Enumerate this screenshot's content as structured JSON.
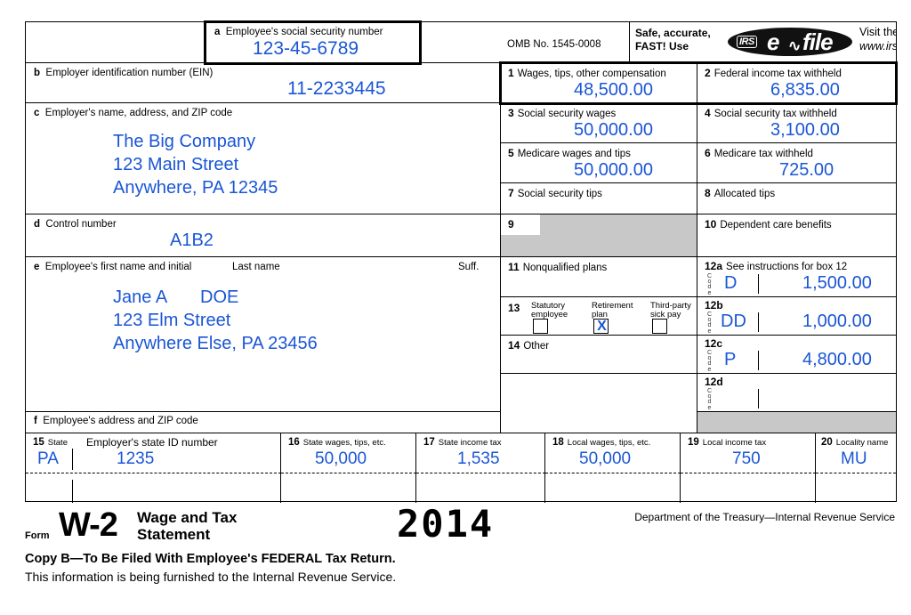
{
  "form": {
    "omb": "OMB No. 1545-0008",
    "efile": {
      "safe_line1": "Safe, accurate,",
      "safe_line2": "FAST! Use",
      "logo_irs": "IRS",
      "logo_e": "e",
      "logo_bolt": "✐",
      "logo_file": "file",
      "visit_line1": "Visit the IRS website at",
      "visit_line2": "www.irs.gov/efile"
    },
    "box_a": {
      "letter": "a",
      "label": "Employee's social security number",
      "value": "123-45-6789"
    },
    "box_b": {
      "letter": "b",
      "label": "Employer identification number (EIN)",
      "value": "11-2233445"
    },
    "box_c": {
      "letter": "c",
      "label": "Employer's name, address, and ZIP code",
      "line1": "The Big Company",
      "line2": "123 Main Street",
      "line3": "Anywhere, PA 12345"
    },
    "box_d": {
      "letter": "d",
      "label": "Control number",
      "value": "A1B2"
    },
    "box_e": {
      "letter": "e",
      "label_first": "Employee's first name and initial",
      "label_last": "Last name",
      "label_suffix": "Suff.",
      "first_name": "Jane A",
      "last_name": "DOE",
      "line2": "123 Elm Street",
      "line3": "Anywhere Else, PA 23456"
    },
    "box_f": {
      "letter": "f",
      "label": "Employee's address and ZIP code"
    },
    "box_1": {
      "num": "1",
      "label": "Wages, tips, other compensation",
      "value": "48,500.00"
    },
    "box_2": {
      "num": "2",
      "label": "Federal income tax withheld",
      "value": "6,835.00"
    },
    "box_3": {
      "num": "3",
      "label": "Social security wages",
      "value": "50,000.00"
    },
    "box_4": {
      "num": "4",
      "label": "Social security tax withheld",
      "value": "3,100.00"
    },
    "box_5": {
      "num": "5",
      "label": "Medicare wages and tips",
      "value": "50,000.00"
    },
    "box_6": {
      "num": "6",
      "label": "Medicare tax withheld",
      "value": "725.00"
    },
    "box_7": {
      "num": "7",
      "label": "Social security tips",
      "value": ""
    },
    "box_8": {
      "num": "8",
      "label": "Allocated tips",
      "value": ""
    },
    "box_9": {
      "num": "9",
      "label": "",
      "value": ""
    },
    "box_10": {
      "num": "10",
      "label": "Dependent care benefits",
      "value": ""
    },
    "box_11": {
      "num": "11",
      "label": "Nonqualified plans",
      "value": ""
    },
    "box_12_header": "See instructions for box 12",
    "code_letters": [
      "C",
      "o",
      "d",
      "e"
    ],
    "box_12a": {
      "num": "12a",
      "code": "D",
      "value": "1,500.00"
    },
    "box_12b": {
      "num": "12b",
      "code": "DD",
      "value": "1,000.00"
    },
    "box_12c": {
      "num": "12c",
      "code": "P",
      "value": "4,800.00"
    },
    "box_12d": {
      "num": "12d",
      "code": "",
      "value": ""
    },
    "box_13": {
      "num": "13",
      "statutory_line1": "Statutory",
      "statutory_line2": "employee",
      "statutory_checked": "",
      "retirement_line1": "Retirement",
      "retirement_line2": "plan",
      "retirement_checked": "X",
      "thirdparty_line1": "Third-party",
      "thirdparty_line2": "sick pay",
      "thirdparty_checked": ""
    },
    "box_14": {
      "num": "14",
      "label": "Other",
      "value": ""
    },
    "box_15": {
      "num": "15",
      "label": "State",
      "label2": "Employer's state ID number",
      "state": "PA",
      "id": "1235",
      "state2": "",
      "id2": ""
    },
    "box_16": {
      "num": "16",
      "label": "State wages, tips, etc.",
      "value": "50,000",
      "value2": ""
    },
    "box_17": {
      "num": "17",
      "label": "State income tax",
      "value": "1,535",
      "value2": ""
    },
    "box_18": {
      "num": "18",
      "label": "Local wages, tips, etc.",
      "value": "50,000",
      "value2": ""
    },
    "box_19": {
      "num": "19",
      "label": "Local income tax",
      "value": "750",
      "value2": ""
    },
    "box_20": {
      "num": "20",
      "label": "Locality name",
      "value": "MU",
      "value2": ""
    }
  },
  "footer": {
    "form_word": "Form",
    "form_name": "W-2",
    "title_line1": "Wage and Tax",
    "title_line2": "Statement",
    "year": "2014",
    "agency": "Department of the Treasury—Internal Revenue Service",
    "copy_line": "Copy B—To Be Filed With Employee's FEDERAL Tax Return.",
    "furnished_line": "This information is being furnished to the Internal Revenue Service."
  },
  "colors": {
    "ink": "#1a56d6",
    "text": "#000000",
    "shade": "#c8c8c8"
  }
}
